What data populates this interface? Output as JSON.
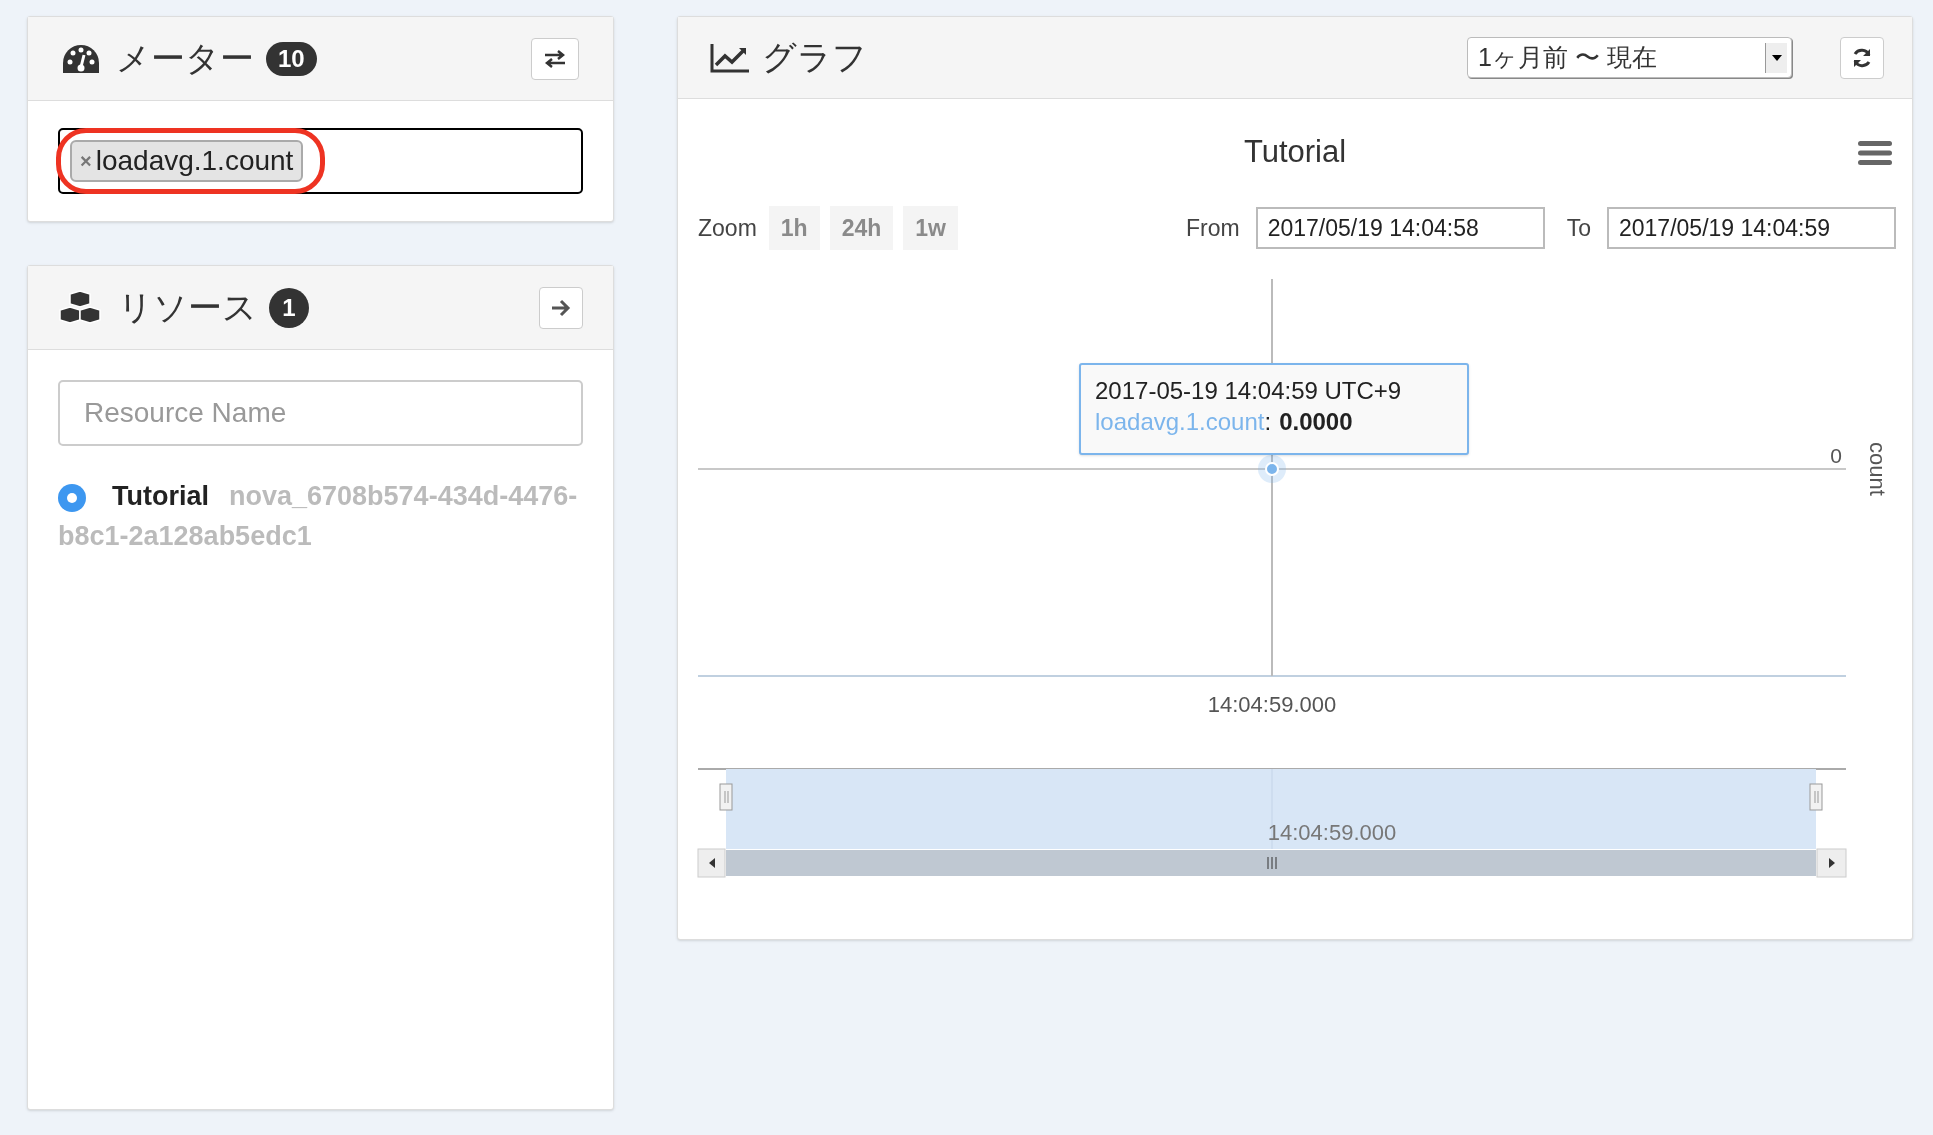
{
  "meter_panel": {
    "title": "メーター",
    "count": "10",
    "tags": [
      {
        "label": "loadavg.1.count",
        "remove": "×",
        "highlighted": true
      }
    ]
  },
  "resource_panel": {
    "title": "リソース",
    "count": "1",
    "search": {
      "placeholder": "Resource Name"
    },
    "resources": [
      {
        "name": "Tutorial",
        "id": "nova_6708b574-434d-4476-b8c1-2a128ab5edc1",
        "selected": true
      }
    ]
  },
  "graph_panel": {
    "title": "グラフ",
    "range_select": {
      "value": "1ヶ月前 〜 現在"
    },
    "zoom": {
      "label": "Zoom",
      "buttons": [
        {
          "label": "1h",
          "disabled": true
        },
        {
          "label": "24h",
          "disabled": true
        },
        {
          "label": "1w",
          "disabled": true
        }
      ]
    },
    "from": {
      "label": "From",
      "value": "2017/05/19 14:04:58"
    },
    "to": {
      "label": "To",
      "value": "2017/05/19 14:04:59"
    },
    "chart": {
      "title": "Tutorial",
      "y_tick": "0",
      "y_title": "count",
      "x_label": "14:04:59.000"
    },
    "tooltip": {
      "time": "2017-05-19 14:04:59 UTC+9",
      "series": "loadavg.1.count",
      "separator": ":",
      "value": "0.0000"
    },
    "navigator": {
      "label": "14:04:59.000"
    }
  }
}
